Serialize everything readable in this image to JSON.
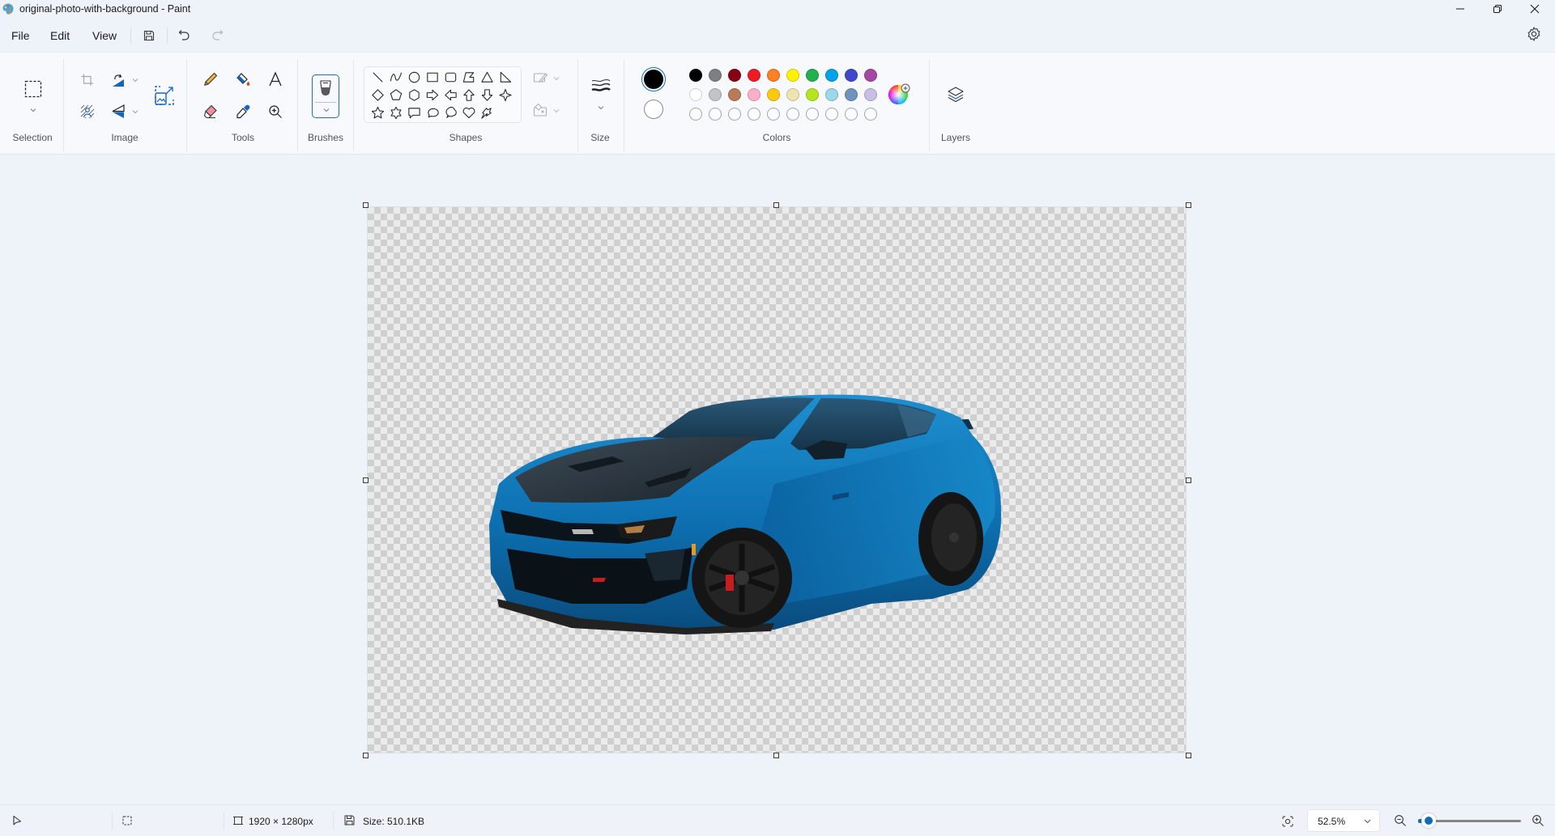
{
  "window": {
    "title": "original-photo-with-background - Paint",
    "app_icon": "paint-palette-icon",
    "controls": [
      "minimize-icon",
      "maximize-icon",
      "close-icon"
    ]
  },
  "menu": {
    "items": [
      "File",
      "Edit",
      "View"
    ],
    "quick_actions": [
      "save-icon",
      "undo-icon",
      "redo-icon"
    ],
    "settings_icon": "gear-icon"
  },
  "ribbon": {
    "groups": {
      "selection": {
        "label": "Selection",
        "icons": [
          "rectangle-selection-icon"
        ]
      },
      "image": {
        "label": "Image",
        "icons": [
          "crop-icon",
          "rotate-icon",
          "remove-background-icon",
          "flip-icon",
          "resize-icon"
        ]
      },
      "tools": {
        "label": "Tools",
        "icons": [
          "pencil-icon",
          "fill-icon",
          "text-icon",
          "eraser-icon",
          "color-picker-icon",
          "magnifier-icon"
        ]
      },
      "brushes": {
        "label": "Brushes",
        "icons": [
          "brush-icon"
        ]
      },
      "shapes": {
        "label": "Shapes",
        "items": [
          "line",
          "curve",
          "oval",
          "rectangle",
          "rounded-rectangle",
          "polygon",
          "triangle",
          "right-triangle",
          "diamond",
          "pentagon",
          "hexagon",
          "right-arrow",
          "left-arrow",
          "up-arrow",
          "down-arrow",
          "four-point-star",
          "five-point-star",
          "six-point-star",
          "rectangular-callout",
          "oval-callout",
          "cloud-callout",
          "heart",
          "lightning"
        ],
        "outline_icon": "shape-outline-icon",
        "fill_icon": "shape-fill-icon"
      },
      "size": {
        "label": "Size",
        "icons": [
          "stroke-size-icon"
        ]
      },
      "colors": {
        "label": "Colors",
        "primary": "#000000",
        "secondary": "#ffffff",
        "palette_row1": [
          "#000000",
          "#7f7f7f",
          "#880015",
          "#ed1c24",
          "#ff7f27",
          "#fff200",
          "#22b14c",
          "#00a2e8",
          "#3f48cc",
          "#a349a4"
        ],
        "palette_row2": [
          "#ffffff",
          "#c3c3c3",
          "#b97a57",
          "#ffaec9",
          "#ffc90e",
          "#efe4b0",
          "#b5e61d",
          "#99d9ea",
          "#7092be",
          "#c8bfe7"
        ],
        "custom_slots": 10,
        "edit_colors_icon": "color-wheel-icon"
      },
      "layers": {
        "label": "Layers",
        "icons": [
          "layers-icon"
        ]
      }
    }
  },
  "canvas": {
    "content": "blue sports car with transparent background",
    "background": "transparent-checkerboard"
  },
  "status": {
    "pointer_icon": "cursor-icon",
    "selection_icon": "selection-size-icon",
    "canvas_size": "1920 × 1280px",
    "file_size": "Size: 510.1KB",
    "zoom_value": "52.5%",
    "zoom_percent": 52.5,
    "fit_icon": "fit-to-window-icon"
  }
}
